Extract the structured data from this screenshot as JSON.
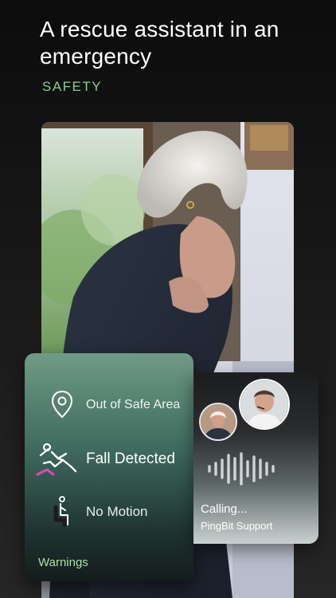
{
  "header": {
    "title": "A rescue assistant in an emergency",
    "category": "SAFETY"
  },
  "warnings_card": {
    "items": [
      {
        "label": "Out of Safe Area",
        "icon": "location-pin-icon"
      },
      {
        "label": "Fall Detected",
        "icon": "fall-person-icon"
      },
      {
        "label": "No Motion",
        "icon": "seated-person-icon"
      }
    ],
    "title": "Warnings",
    "accent_color": "#7fd58a"
  },
  "call_card": {
    "status": "Calling...",
    "contact": "PingBit Support"
  }
}
